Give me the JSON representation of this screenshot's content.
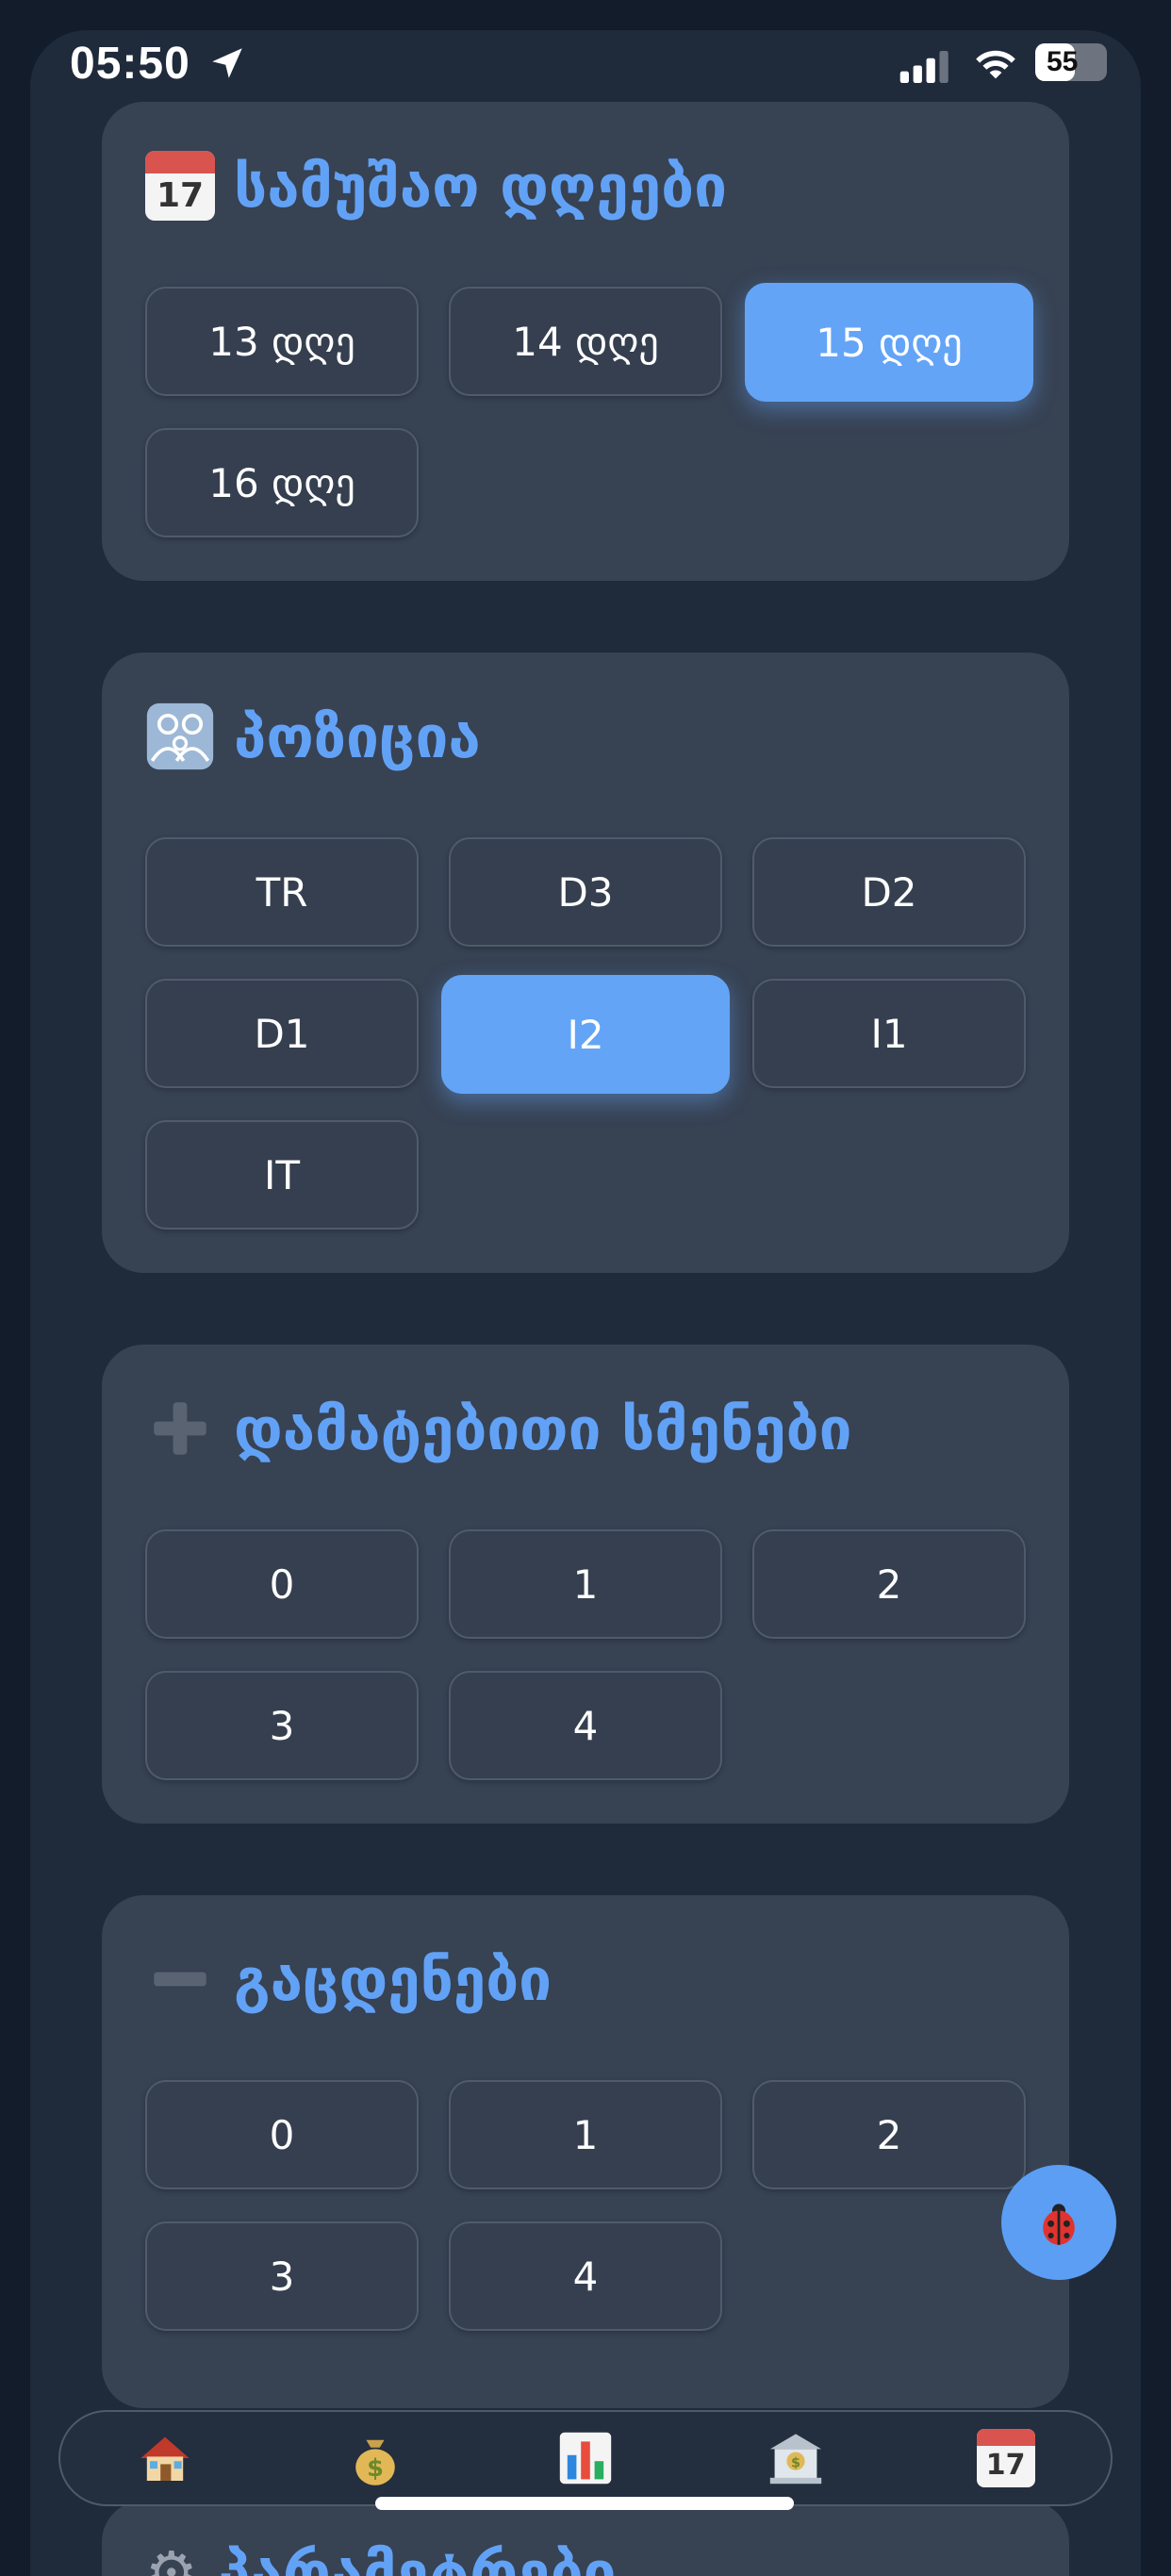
{
  "status_bar": {
    "time": "05:50",
    "battery": "55",
    "battery_level": 0.55
  },
  "sections": {
    "work_days": {
      "title": "სამუშაო დღეები",
      "icon": "calendar-icon",
      "calendar_day": "17",
      "options": [
        "13 დღე",
        "14 დღე",
        "15 დღე",
        "16 დღე"
      ],
      "selected": "15 დღე"
    },
    "position": {
      "title": "პოზიცია",
      "icon": "people-icon",
      "options": [
        "TR",
        "D3",
        "D2",
        "D1",
        "I2",
        "I1",
        "IT"
      ],
      "selected": "I2"
    },
    "extra_shifts": {
      "title": "დამატებითი სმენები",
      "icon": "plus-icon",
      "options": [
        "0",
        "1",
        "2",
        "3",
        "4"
      ]
    },
    "missed": {
      "title": "გაცდენები",
      "icon": "minus-icon",
      "options": [
        "0",
        "1",
        "2",
        "3",
        "4"
      ]
    },
    "next_peek": {
      "title": "პარამეტრები",
      "icon": "gear-icon"
    }
  },
  "bottom_nav": {
    "items": [
      {
        "icon": "house-icon"
      },
      {
        "icon": "money-bag-icon"
      },
      {
        "icon": "bar-chart-icon"
      },
      {
        "icon": "bank-icon"
      },
      {
        "icon": "calendar-icon",
        "day": "17"
      }
    ]
  },
  "fab": {
    "icon": "ladybug-icon"
  },
  "colors": {
    "accent": "#63a4f7",
    "card": "#374253",
    "background": "#1f2a3b"
  }
}
